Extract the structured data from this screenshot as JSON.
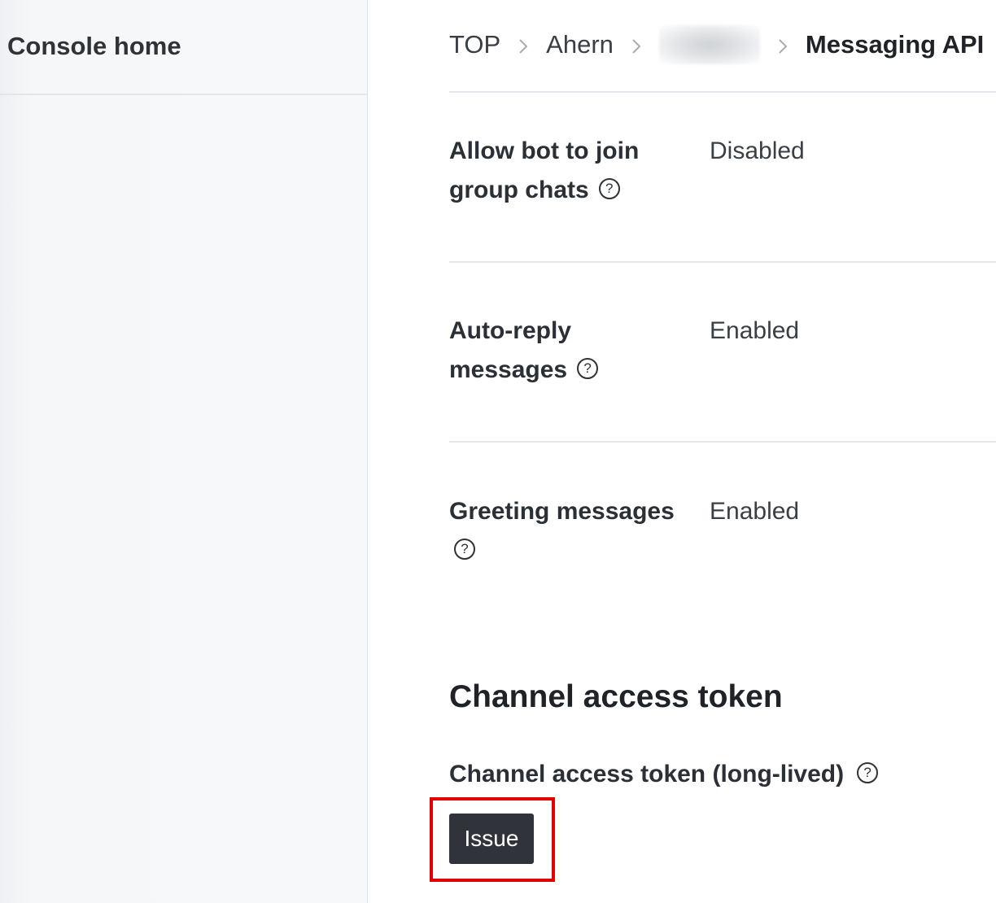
{
  "sidebar": {
    "console_home": "Console home"
  },
  "breadcrumb": {
    "items": [
      "TOP",
      "Ahern"
    ],
    "current": "Messaging API"
  },
  "settings": [
    {
      "label_line1": "Allow bot to join",
      "label_line2": "group chats",
      "value": "Disabled"
    },
    {
      "label_line1": "Auto-reply",
      "label_line2": "messages",
      "value": "Enabled"
    },
    {
      "label_line1": "Greeting messages",
      "label_line2": "",
      "value": "Enabled"
    }
  ],
  "token_section": {
    "title": "Channel access token",
    "subtitle": "Channel access token (long-lived)",
    "issue_button": "Issue"
  },
  "icons": {
    "help": "help-circle-icon",
    "breadcrumb_separator": "chevron-right-icon"
  },
  "colors": {
    "button_bg": "#30343a",
    "highlight": "#e00000"
  }
}
